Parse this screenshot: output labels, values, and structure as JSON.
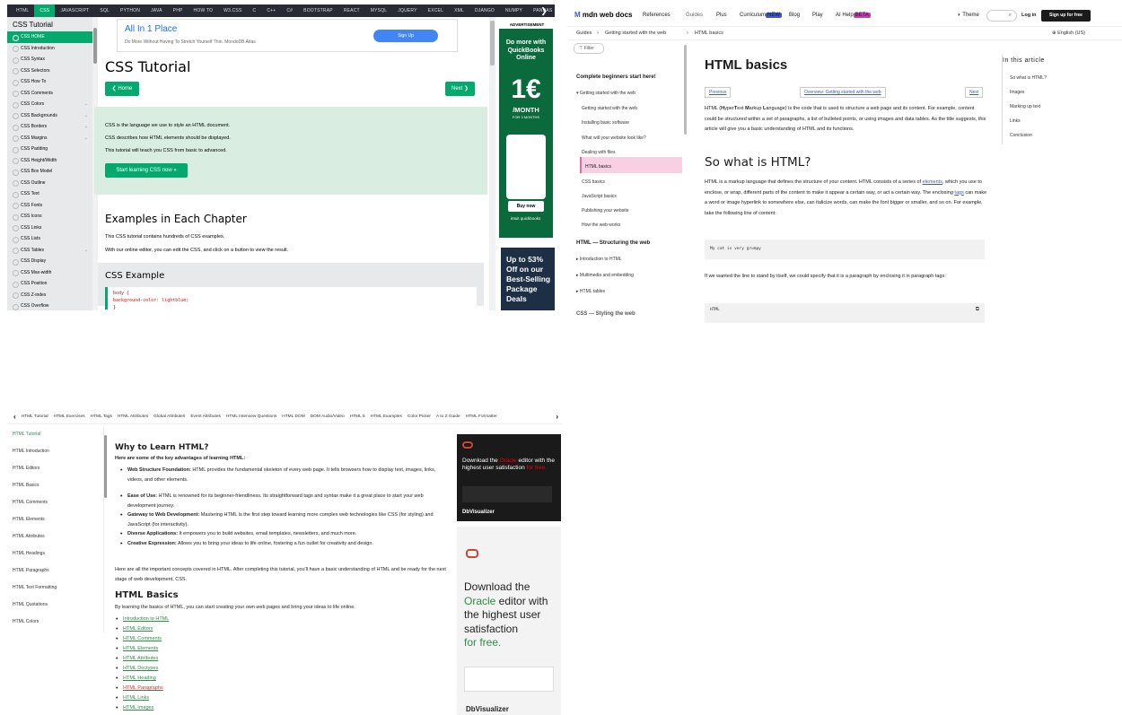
{
  "w3": {
    "topnav": [
      "HTML",
      "CSS",
      "JAVASCRIPT",
      "SQL",
      "PYTHON",
      "JAVA",
      "PHP",
      "HOW TO",
      "W3.CSS",
      "C",
      "C++",
      "C#",
      "BOOTSTRAP",
      "REACT",
      "MYSQL",
      "JQUERY",
      "EXCEL",
      "XML",
      "DJANGO",
      "NUMPY",
      "PANDAS"
    ],
    "active_tab": "CSS",
    "sidebar_title": "CSS Tutorial",
    "sidebar_items": [
      "CSS HOME",
      "CSS Introduction",
      "CSS Syntax",
      "CSS Selectors",
      "CSS How To",
      "CSS Comments",
      "CSS Colors",
      "CSS Backgrounds",
      "CSS Borders",
      "CSS Margins",
      "CSS Padding",
      "CSS Height/Width",
      "CSS Box Model",
      "CSS Outline",
      "CSS Text",
      "CSS Fonts",
      "CSS Icons",
      "CSS Links",
      "CSS Lists",
      "CSS Tables",
      "CSS Display",
      "CSS Max-width",
      "CSS Position",
      "CSS Z-index",
      "CSS Overflow"
    ],
    "ad_title": "All In 1 Place",
    "ad_subtitle": "Do More Without Having To Stretch Yourself Thin. MondoDB Atlas",
    "ad_button": "Sign Up",
    "h1": "CSS Tutorial",
    "home_btn": "❮ Home",
    "next_btn": "Next ❯",
    "intro": [
      "CSS is the language we use to style an HTML document.",
      "CSS describes how HTML elements should be displayed.",
      "This tutorial will teach you CSS from basic to advanced."
    ],
    "start_btn": "Start learning CSS now »",
    "h2_examples": "Examples in Each Chapter",
    "ex_p1": "This CSS tutorial contains hundreds of CSS examples.",
    "ex_p2": "With our online editor, you can edit the CSS, and click on a button to view the result.",
    "h2_example": "CSS Example",
    "code1": "body {",
    "code2": "  background-color: lightblue;",
    "code3": "}",
    "ad_label": "ADVERTISEMENT",
    "qb_title": "Do more with QuickBooks Online",
    "qb_price": "1€",
    "qb_month": "/MONTH",
    "qb_for": "FOR 3 MONTHS",
    "qb_buy": "Buy now",
    "qb_logo": "intuit quickbooks",
    "dk_text": "Up to 53% Off on our Best-Selling Package Deals"
  },
  "mdn": {
    "logo_m": "M",
    "logo_text": "mdn web docs",
    "nav": [
      "References",
      "Guides",
      "Plus",
      "Curriculum",
      "Blog",
      "Play",
      "AI Help"
    ],
    "badge_new": "NEW",
    "badge_beta": "BETA",
    "theme": "Theme",
    "login": "Log in",
    "signup": "Sign up for free",
    "breadcrumb": [
      "Guides",
      "›",
      "Getting started with the web",
      "›",
      "HTML basics"
    ],
    "lang": "English (US)",
    "filter": "Filter",
    "sec1": "Complete beginners start here!",
    "sec1_sub": "▾ Getting started with the web",
    "sec1_items": [
      "Getting started with the web",
      "Installing basic software",
      "What will your website look like?",
      "Dealing with files",
      "HTML basics",
      "CSS basics",
      "JavaScript basics",
      "Publishing your website",
      "How the web works"
    ],
    "sec2": "HTML — Structuring the web",
    "sec2_items": [
      "▸ Introduction to HTML",
      "▸ Multimedia and embedding",
      "▸ HTML tables"
    ],
    "sec3": "CSS — Styling the web",
    "h1": "HTML basics",
    "prev": "Previous",
    "overview": "Overview: Getting started with the web",
    "next": "Next",
    "p1a": "HTML (",
    "p1b": "H",
    "p1c": "yper",
    "p1d": "T",
    "p1e": "ext ",
    "p1f": "M",
    "p1g": "arkup ",
    "p1h": "L",
    "p1i": "anguage) is the code that is used to structure a web page and its content. For example, content could be structured within a set of paragraphs, a list of bulleted points, or using images and data tables. As the title suggests, this article will give you a basic understanding of HTML and its functions.",
    "h2": "So what is HTML?",
    "p2a": "HTML is a markup language that defines the structure of your content. HTML consists of a series of ",
    "p2b": "elements",
    "p2c": ", which you use to enclose, or wrap, different parts of the content to make it appear a certain way, or act a certain way. The enclosing ",
    "p2d": "tags",
    "p2e": " can make a word or image hyperlink to somewhere else, can italicize words, can make the font bigger or smaller, and so on. For example, take the following line of content:",
    "code1": "My cat is very grumpy",
    "p3": "If we wanted the line to stand by itself, we could specify that it is a paragraph by enclosing it in paragraph tags:",
    "code2_label": "HTML",
    "toc_title": "In this article",
    "toc": [
      "So what is HTML?",
      "Images",
      "Marking up text",
      "Links",
      "Conclusion"
    ]
  },
  "gfg": {
    "topnav": [
      "HTML Tutorial",
      "HTML Exercises",
      "HTML Tags",
      "HTML Attributes",
      "Global Attributes",
      "Event Attributes",
      "HTML Interview Questions",
      "HTML DOM",
      "DOM Audio/Video",
      "HTML 5",
      "HTML Examples",
      "Color Picker",
      "A to Z Guide",
      "HTML Formatter"
    ],
    "sidebar": [
      "HTML Tutorial",
      "HTML Introduction",
      "HTML Editors",
      "HTML Basics",
      "HTML Comments",
      "HTML Elements",
      "HTML Attributes",
      "HTML Headings",
      "HTML Paragraphs",
      "HTML Text Formatting",
      "HTML Quotations",
      "HTML Colors"
    ],
    "h_why": "Why to Learn HTML?",
    "p_key": "Here are some of the key advantages of learning HTML:",
    "bullets": [
      {
        "b": "Web Structure Foundation:",
        "t": " HTML provides the fundamental skeleton of every web page. It tells browsers how to display text, images, links, videos, and other elements."
      },
      {
        "b": "Ease of Use:",
        "t": " HTML is renowned for its beginner-friendliness. Its straightforward tags and syntax make it a great place to start your web development journey."
      },
      {
        "b": "Gateway to Web Development:",
        "t": " Mastering HTML is the first step toward learning more complex web technologies like CSS (for styling) and JavaScript (for interactivity)."
      },
      {
        "b": "Diverse Applications:",
        "t": " It empowers you to build websites, email templates, newsletters, and much more."
      },
      {
        "b": "Creative Expression:",
        "t": " Allows you to bring your ideas to life online, fostering a fun outlet for creativity and design."
      }
    ],
    "p_concepts": "Here are all the important concepts covered in HTML. After completing this tutorial, you'll have a basic understanding of HTML and be ready for the next stage of web development, CSS.",
    "h_basics": "HTML Basics",
    "p_basics": "By learning the basics of HTML, you can start creating your own web pages and bring your ideas to life online.",
    "links": [
      "Introduction to HTML",
      "HTML Editors",
      "HTML Comments",
      "HTML Elements",
      "HTML Attributes",
      "HTML Doctypes",
      "HTML Heading",
      "HTML Paragraphs",
      "HTML Links",
      "HTML Images"
    ],
    "ad1_a": "Download the ",
    "ad1_b": "Oracle",
    "ad1_c": " editor with the highest user satisfaction ",
    "ad1_d": "for free.",
    "ad_brand": "DbVisualizer",
    "ad2_a": "Download the",
    "ad2_b": "Oracle",
    "ad2_c": " editor with the highest user satisfaction",
    "ad2_d": "for free."
  }
}
